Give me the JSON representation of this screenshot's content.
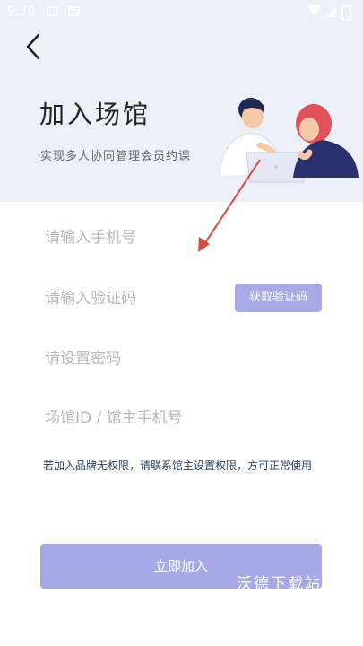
{
  "status_bar": {
    "time": "9:20"
  },
  "header": {
    "title": "加入场馆",
    "subtitle": "实现多人协同管理会员约课"
  },
  "form": {
    "phone_placeholder": "请输入手机号",
    "code_placeholder": "请输入验证码",
    "get_code_label": "获取验证码",
    "password_placeholder": "请设置密码",
    "venue_placeholder": "场馆ID / 馆主手机号"
  },
  "notice": "若加入品牌无权限，请联系馆主设置权限，方可正常使用",
  "join_button": "立即加入",
  "watermark": "沃德下载站",
  "colors": {
    "hero_bg": "#edeff9",
    "button_accent": "#a7a9e6",
    "annotation_arrow": "#d9463c"
  },
  "icons": {
    "back": "chevron-left-icon",
    "wifi": "wifi-icon",
    "signal": "signal-icon",
    "battery": "battery-icon"
  }
}
